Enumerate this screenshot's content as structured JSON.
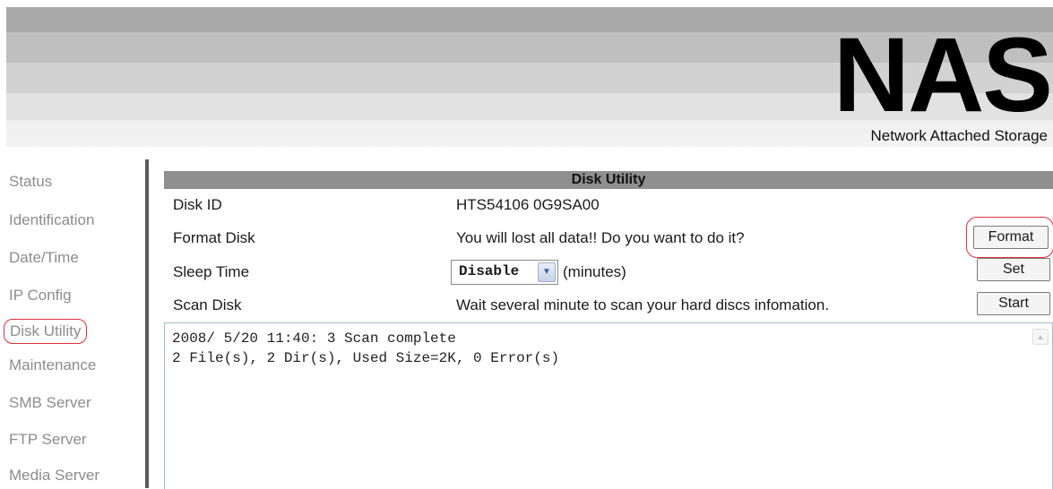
{
  "header": {
    "logo": "NAS",
    "subtitle": "Network Attached Storage"
  },
  "sidebar": {
    "items": [
      {
        "label": "Status"
      },
      {
        "label": "Identification"
      },
      {
        "label": "Date/Time"
      },
      {
        "label": "IP Config"
      },
      {
        "label": "Disk Utility",
        "active": true
      },
      {
        "label": "Maintenance"
      },
      {
        "label": "SMB Server"
      },
      {
        "label": "FTP Server"
      },
      {
        "label": "Media Server"
      }
    ]
  },
  "panel": {
    "title": "Disk Utility",
    "rows": {
      "disk_id": {
        "label": "Disk ID",
        "value": "HTS54106 0G9SA00"
      },
      "format": {
        "label": "Format Disk",
        "value": "You will lost all data!! Do you want to do it?",
        "button": "Format"
      },
      "sleep": {
        "label": "Sleep Time",
        "selected": "Disable",
        "units": "(minutes)",
        "button": "Set"
      },
      "scan": {
        "label": "Scan Disk",
        "value": "Wait several minute to scan your hard discs infomation.",
        "button": "Start"
      }
    },
    "log": [
      "2008/ 5/20 11:40: 3 Scan complete",
      "2 File(s), 2 Dir(s), Used Size=2K, 0 Error(s)"
    ]
  },
  "colors": {
    "highlight": "#e0303a",
    "header_bar": "#8f8f8f",
    "nav_text": "#8c8c8c"
  }
}
